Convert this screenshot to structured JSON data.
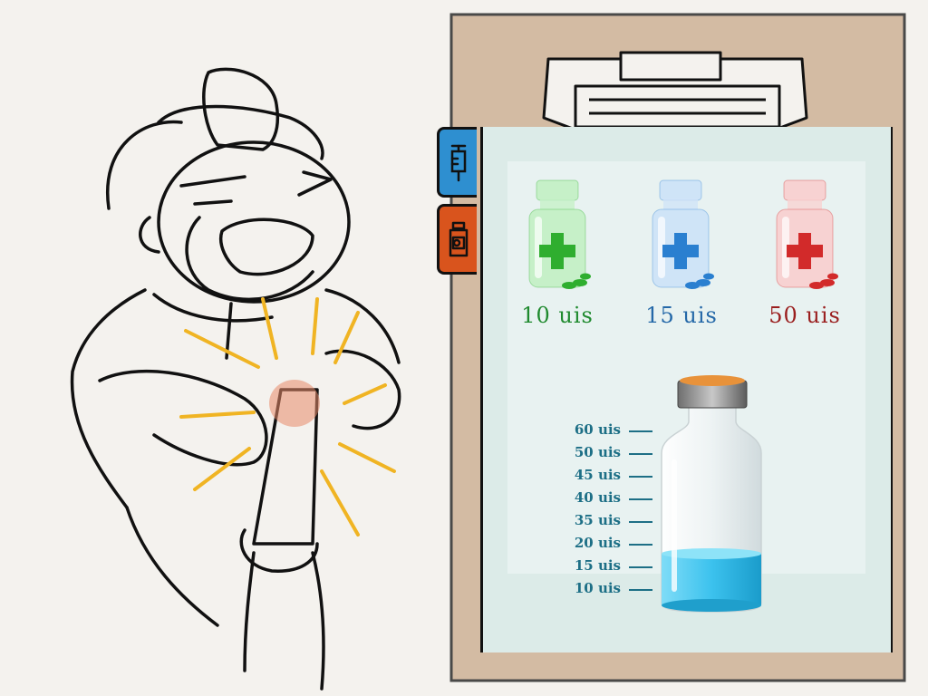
{
  "tabs": [
    {
      "icon": "syringe-icon"
    },
    {
      "icon": "bottle-icon"
    }
  ],
  "medicines": [
    {
      "label": "10 uis",
      "color": "#1f8a2e",
      "cross": "#2fae2f",
      "tint": "#c6f0c8"
    },
    {
      "label": "15 uis",
      "color": "#2468a8",
      "cross": "#2a7fd0",
      "tint": "#cfe4f7"
    },
    {
      "label": "50 uis",
      "color": "#9a1e1e",
      "cross": "#d22a2a",
      "tint": "#f7d2d2"
    }
  ],
  "scale": {
    "labels": [
      "60 uis",
      "50 uis",
      "45 uis",
      "40 uis",
      "35 uis",
      "20 uis",
      "15 uis",
      "10 uis"
    ]
  },
  "bottle": {
    "fill_fraction": 0.35,
    "liquid_color": "#3cc2ee",
    "cap_color": "#e8923a"
  }
}
